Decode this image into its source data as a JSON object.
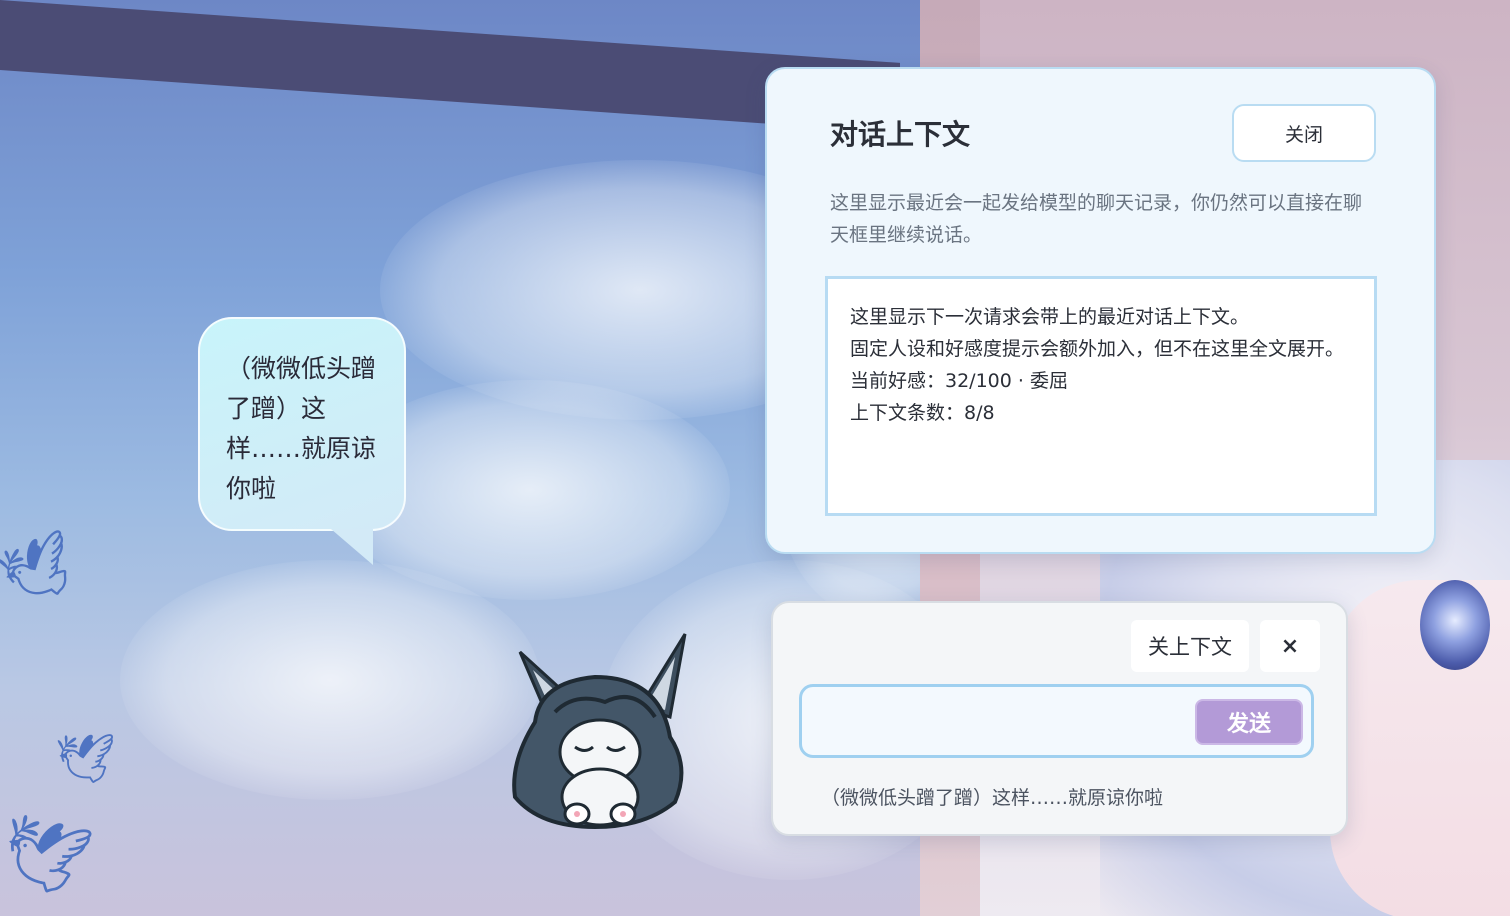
{
  "bubble": {
    "text": "（微微低头蹭了蹭）这样……就原谅你啦"
  },
  "context_panel": {
    "title": "对话上下文",
    "close_label": "关闭",
    "description": "这里显示最近会一起发给模型的聊天记录，你仍然可以直接在聊天框里继续说话。",
    "box_lines": [
      "这里显示下一次请求会带上的最近对话上下文。",
      "固定人设和好感度提示会额外加入，但不在这里全文展开。",
      "当前好感：32/100 · 委屈",
      "上下文条数：8/8"
    ]
  },
  "chat": {
    "toggle_context_label": "关上下文",
    "close_label": "×",
    "input_value": "",
    "input_placeholder": "",
    "send_label": "发送",
    "last_message": "（微微低头蹭了蹭）这样……就原谅你啦"
  },
  "colors": {
    "send_button": "#b39ad7",
    "panel_border": "#b9dcf2",
    "bubble": "#c8f4fa"
  }
}
